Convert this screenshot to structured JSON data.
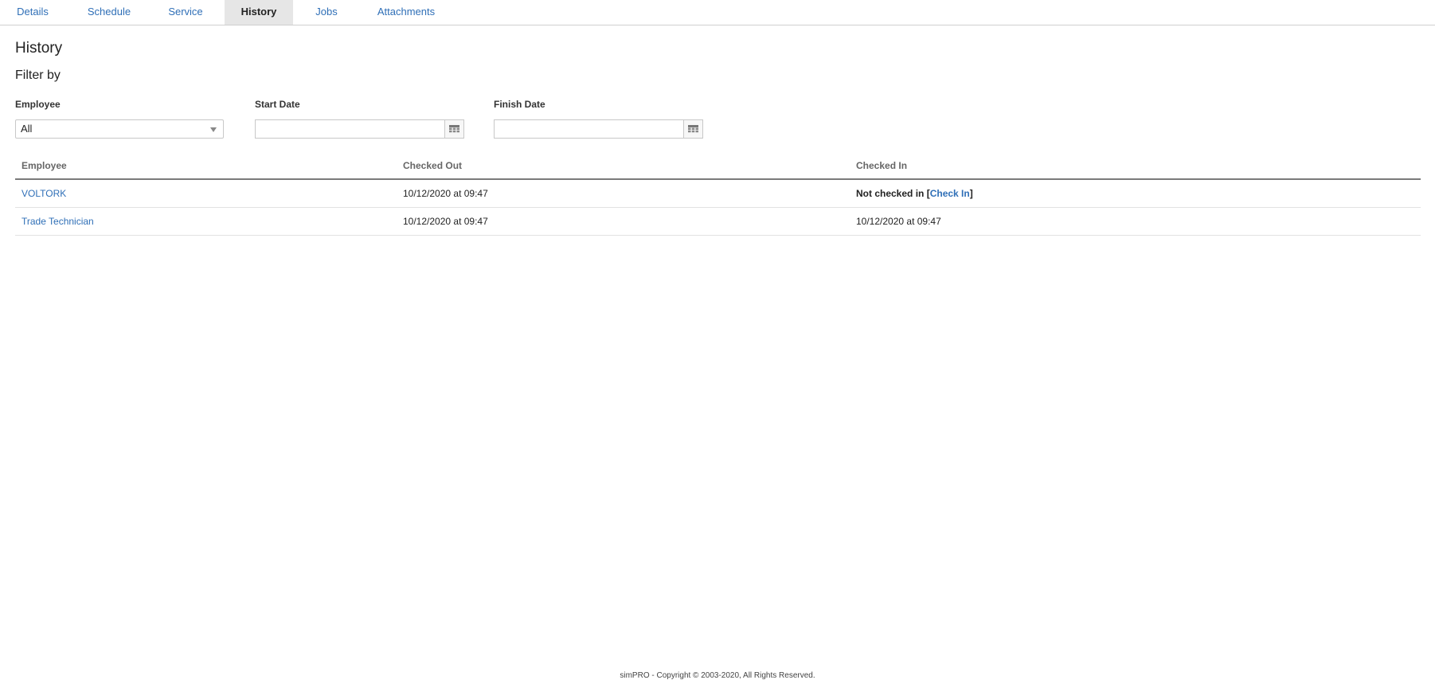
{
  "tabs": [
    {
      "label": "Details",
      "active": false
    },
    {
      "label": "Schedule",
      "active": false
    },
    {
      "label": "Service",
      "active": false
    },
    {
      "label": "History",
      "active": true
    },
    {
      "label": "Jobs",
      "active": false
    },
    {
      "label": "Attachments",
      "active": false
    }
  ],
  "page": {
    "title": "History",
    "filter_title": "Filter by"
  },
  "filters": {
    "employee": {
      "label": "Employee",
      "value": "All"
    },
    "start_date": {
      "label": "Start Date",
      "value": ""
    },
    "finish_date": {
      "label": "Finish Date",
      "value": ""
    }
  },
  "table": {
    "columns": [
      "Employee",
      "Checked Out",
      "Checked In"
    ],
    "rows": [
      {
        "employee": "VOLTORK",
        "checked_out": "10/12/2020 at 09:47",
        "checked_in_status": "Not checked in",
        "bracket_open": "[",
        "check_in_link": "Check In",
        "bracket_close": "]"
      },
      {
        "employee": "Trade Technician",
        "checked_out": "10/12/2020 at 09:47",
        "checked_in": "10/12/2020 at 09:47"
      }
    ]
  },
  "footer": {
    "text": "simPRO - Copyright © 2003-2020, All Rights Reserved."
  },
  "icons": {
    "calendar": "calendar-icon",
    "dropdown": "chevron-down-icon"
  }
}
